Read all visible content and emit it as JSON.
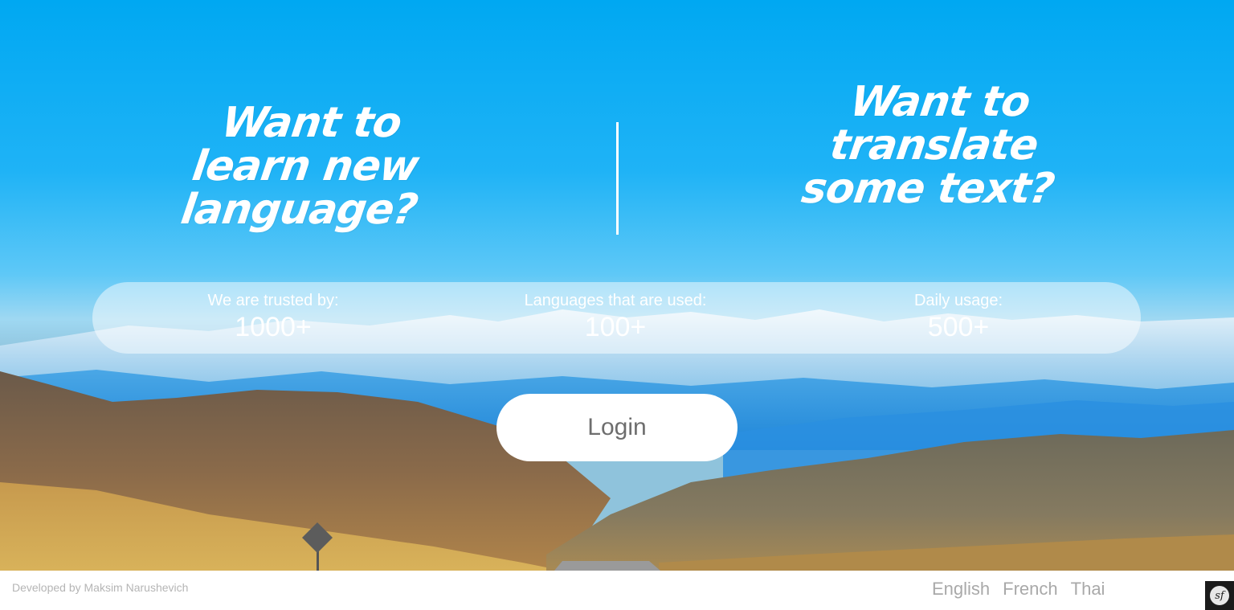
{
  "hero": {
    "left_headline": "Want to learn new language?",
    "right_headline": "Want to translate some text?"
  },
  "stats": [
    {
      "label": "We are trusted by:",
      "value": "1000+"
    },
    {
      "label": "Languages that are used:",
      "value": "100+"
    },
    {
      "label": "Daily usage:",
      "value": "500+"
    }
  ],
  "login_label": "Login",
  "footer": {
    "credit": "Developed by Maksim Narushevich",
    "languages": [
      "English",
      "French",
      "Thai"
    ],
    "toolbar_icon_text": "sf"
  },
  "colors": {
    "sky_top": "#00a8f2",
    "text_white": "#ffffff",
    "footer_text": "#b5b5b5",
    "language_text": "#a9a9a9",
    "login_text": "#6e6e6e"
  },
  "icons": [
    "symfony-toolbar-icon"
  ]
}
